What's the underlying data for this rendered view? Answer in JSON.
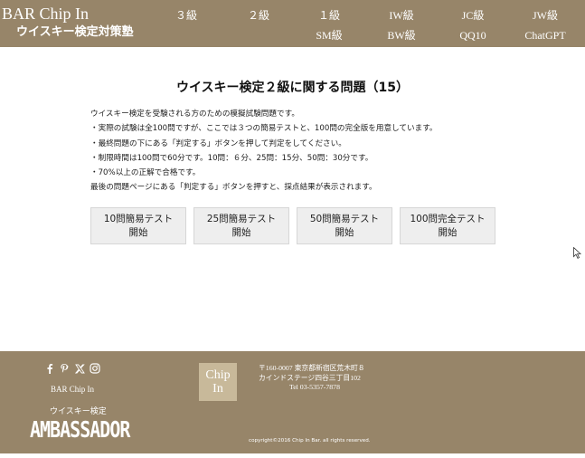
{
  "header": {
    "site_title": "BAR Chip In",
    "site_subtitle": "ウイスキー検定対策塾",
    "nav_top": [
      "３級",
      "２級",
      "１級",
      "IW級",
      "JC級",
      "JW級"
    ],
    "nav_bottom": [
      "SM級",
      "BW級",
      "QQ10",
      "ChatGPT"
    ]
  },
  "main": {
    "title": "ウイスキー検定２級に関する問題（15）",
    "description": [
      "ウイスキー検定を受験される方のための模擬試験問題です。",
      "・実際の試験は全100問ですが、ここでは３つの簡易テストと、100問の完全版を用意しています。",
      "・最終問題の下にある「判定する」ボタンを押して判定をしてください。",
      "・制限時間は100問で60分です。10問：６分、25問：15分、50問：30分です。",
      "・70%以上の正解で合格です。",
      "最後の問題ページにある「判定する」ボタンを押すと、採点結果が表示されます。"
    ],
    "buttons": [
      {
        "line1": "10問簡易テスト",
        "line2": "開始"
      },
      {
        "line1": "25問簡易テスト",
        "line2": "開始"
      },
      {
        "line1": "50問簡易テスト",
        "line2": "開始"
      },
      {
        "line1": "100問完全テスト",
        "line2": "開始"
      }
    ]
  },
  "footer": {
    "social_icons": [
      "facebook-icon",
      "pinterest-icon",
      "x-icon",
      "instagram-icon"
    ],
    "brand": "BAR Chip In",
    "ambassador_small": "ウイスキー検定",
    "ambassador_big": "AMBASSADOR",
    "logo_line1": "Chip",
    "logo_line2": "In",
    "address_line1": "〒160-0007 東京都新宿区荒木町８",
    "address_line2": "カインドステージ四谷三丁目102",
    "tel": "Tel 03-5357-7878",
    "copyright": "copyright©2016 Chip In Bar. all rights reserved."
  },
  "colors": {
    "header_bg": "#978569",
    "footer_bg": "#978569",
    "logo_bg": "#c8b99a",
    "button_bg": "#eeeeee"
  }
}
